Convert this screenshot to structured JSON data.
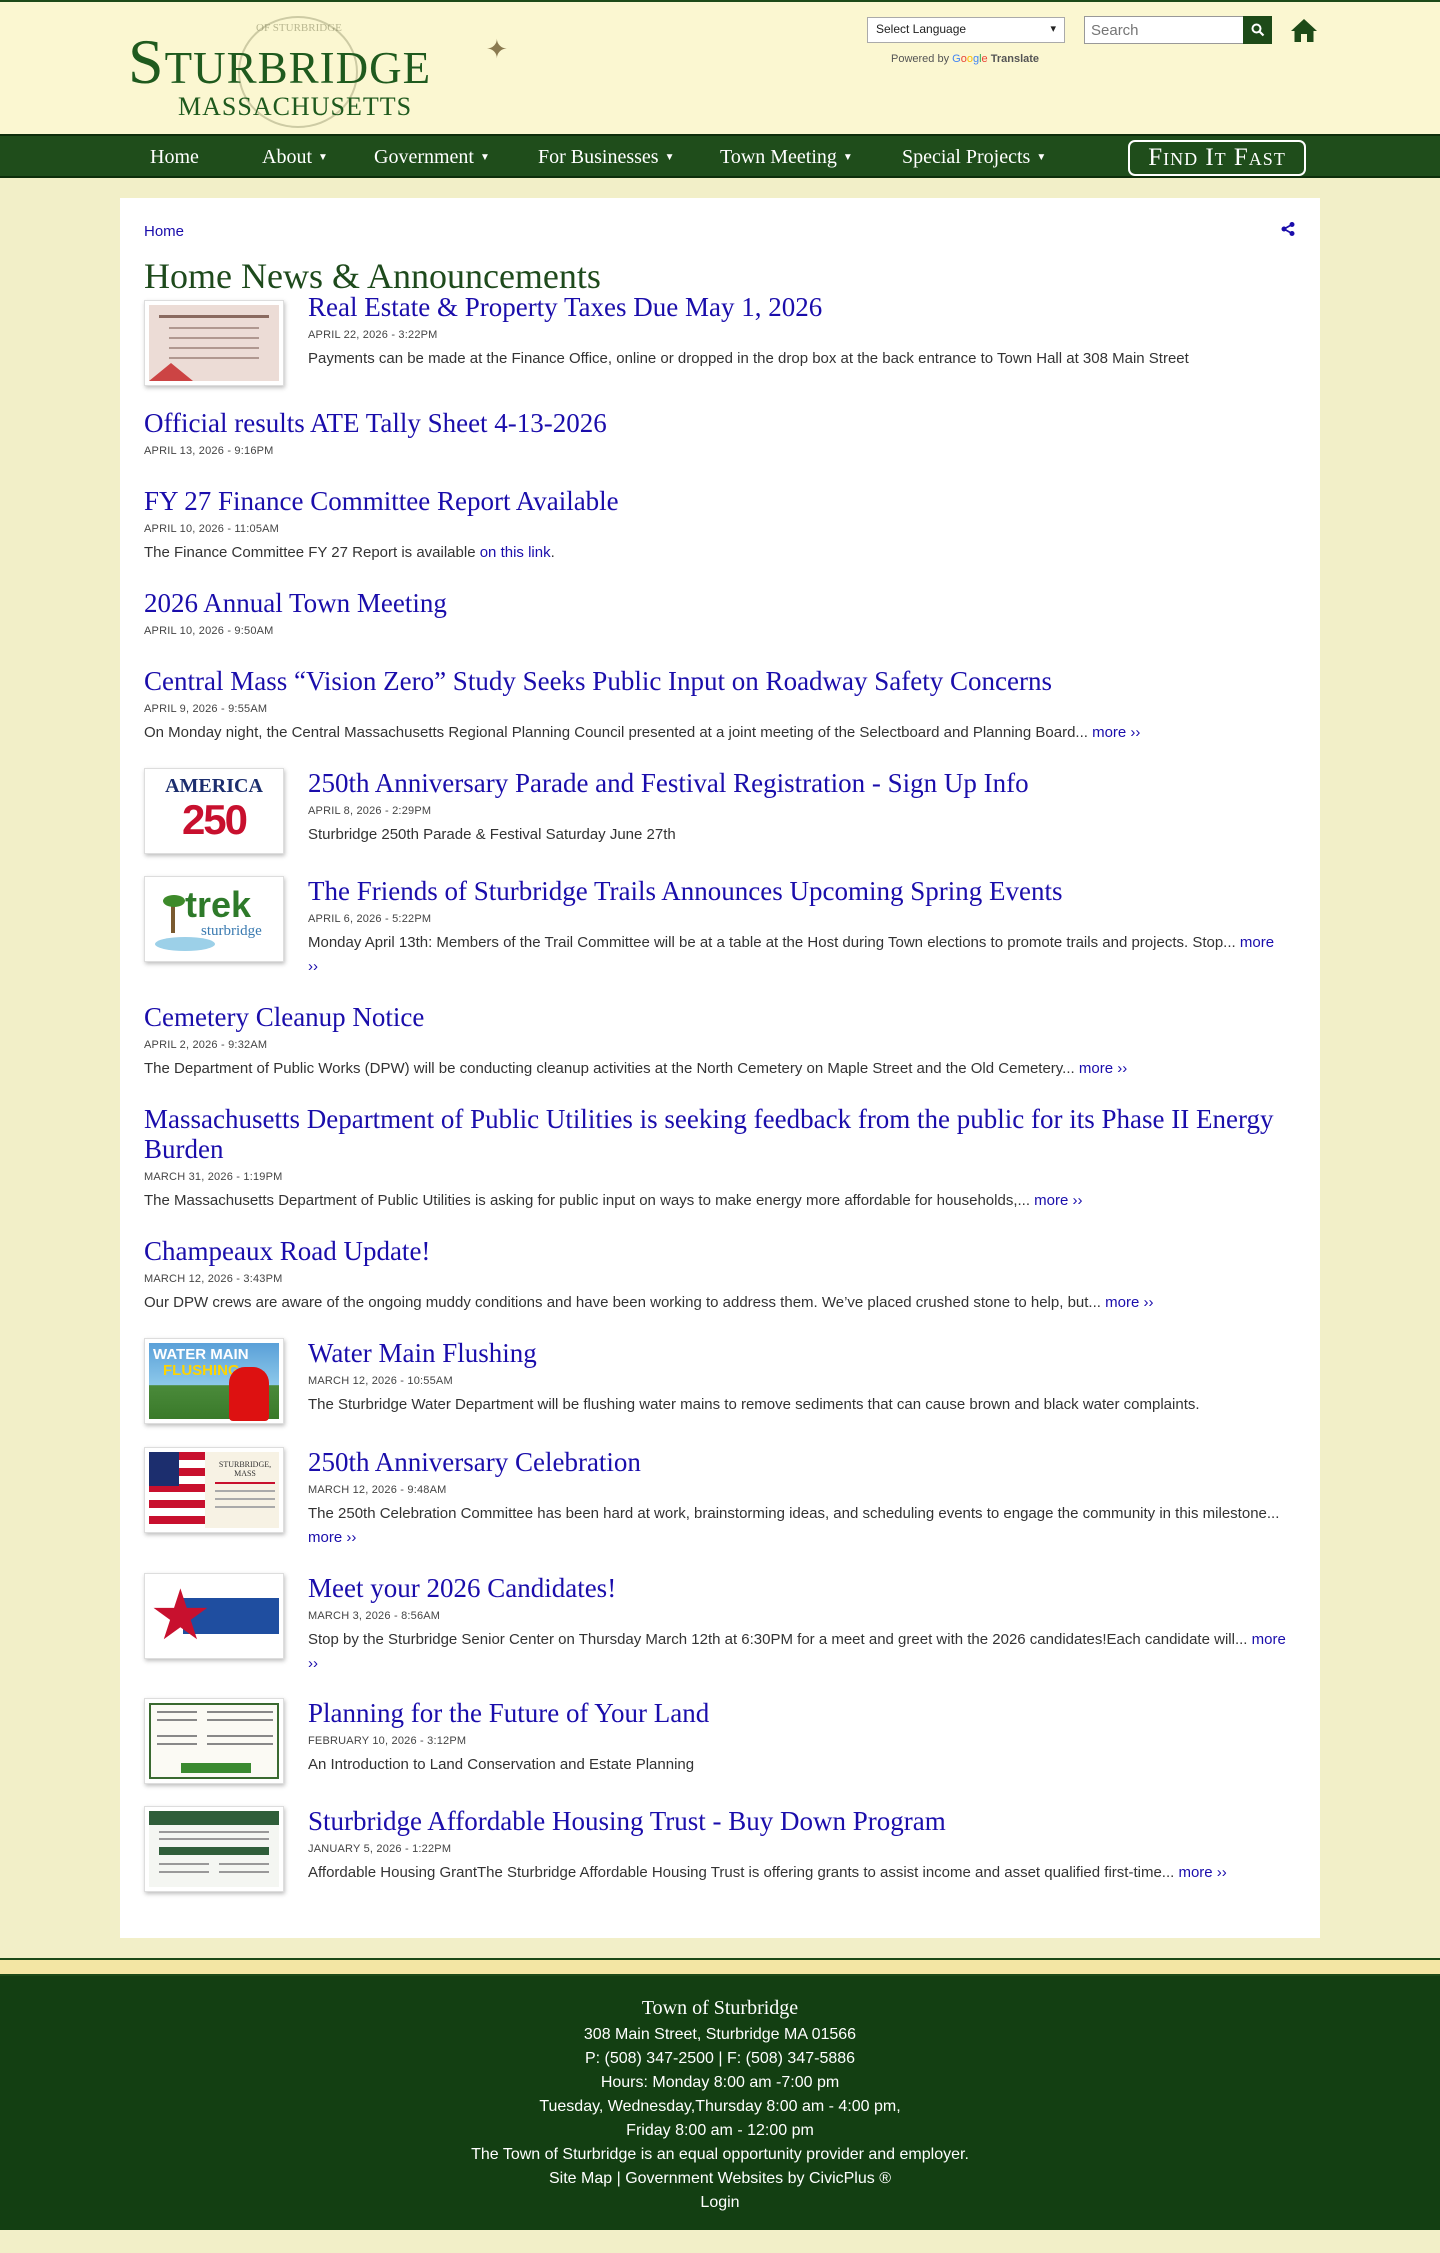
{
  "header": {
    "logo_name": "Sturbridge",
    "logo_state": "MASSACHUSETTS",
    "logo_seal_text": "OF STURBRIDGE",
    "language_select": "Select Language",
    "powered_by": "Powered by",
    "google": [
      "G",
      "o",
      "o",
      "g",
      "l",
      "e"
    ],
    "translate": "Translate",
    "search_placeholder": "Search"
  },
  "nav": {
    "items": [
      {
        "label": "Home",
        "dropdown": false
      },
      {
        "label": "About",
        "dropdown": true
      },
      {
        "label": "Government",
        "dropdown": true
      },
      {
        "label": "For Businesses",
        "dropdown": true
      },
      {
        "label": "Town Meeting",
        "dropdown": true
      },
      {
        "label": "Special Projects",
        "dropdown": true
      }
    ],
    "find_it_fast": "Find It Fast"
  },
  "breadcrumb": "Home",
  "page_title": "Home News & Announcements",
  "news": [
    {
      "title": "Real Estate & Property Taxes Due May 1, 2026",
      "date": "APRIL 22, 2026 - 3:22PM",
      "desc": "Payments can be made at the Finance Office, online or dropped in the drop box at the back entrance to Town Hall at 308 Main Street",
      "more": "",
      "link": "",
      "link_prefix": "",
      "link_suffix": ""
    },
    {
      "title": "Official results ATE Tally Sheet 4-13-2026",
      "date": "APRIL 13, 2026 - 9:16PM",
      "desc": "",
      "more": ""
    },
    {
      "title": "FY 27 Finance Committee Report Available",
      "date": "APRIL 10, 2026 - 11:05AM",
      "desc": "",
      "more": "",
      "link_prefix": "The Finance Committee FY 27 Report is available ",
      "link": "on this link",
      "link_suffix": "."
    },
    {
      "title": "2026 Annual Town Meeting",
      "date": "APRIL 10, 2026 - 9:50AM",
      "desc": "",
      "more": ""
    },
    {
      "title": "Central Mass “Vision Zero” Study Seeks Public Input on Roadway Safety Concerns",
      "date": "APRIL 9, 2026 - 9:55AM",
      "desc": "On Monday night, the Central Massachusetts Regional Planning Council presented at a joint meeting of the Selectboard and Planning Board...",
      "more": "more ››"
    },
    {
      "title": "250th Anniversary Parade and Festival Registration - Sign Up Info",
      "date": "APRIL 8, 2026 - 2:29PM",
      "desc": "Sturbridge 250th Parade & Festival Saturday June 27th",
      "more": ""
    },
    {
      "title": "The Friends of Sturbridge Trails Announces Upcoming Spring Events",
      "date": "APRIL 6, 2026 - 5:22PM",
      "desc": "Monday April 13th: Members of the Trail Committee will be at a table at the Host during Town elections to promote trails and projects. Stop...",
      "more": "more ››"
    },
    {
      "title": "Cemetery Cleanup Notice",
      "date": "APRIL 2, 2026 - 9:32AM",
      "desc": "The Department of Public Works (DPW) will be conducting cleanup activities at the North Cemetery on Maple Street and the Old Cemetery...",
      "more": "more ››"
    },
    {
      "title": "Massachusetts Department of Public Utilities is seeking feedback from the public for its Phase II Energy Burden",
      "date": "MARCH 31, 2026 - 1:19PM",
      "desc": "The Massachusetts Department of Public Utilities is asking for public input on ways to make energy more affordable for households,...",
      "more": "more ››"
    },
    {
      "title": "Champeaux Road Update!",
      "date": "MARCH 12, 2026 - 3:43PM",
      "desc": "Our DPW crews are aware of the ongoing muddy conditions and have been working to address them. We’ve placed crushed stone to help, but...",
      "more": "more ››"
    },
    {
      "title": "Water Main Flushing",
      "date": "MARCH 12, 2026 - 10:55AM",
      "desc": "The Sturbridge Water Department will be flushing water mains to remove sediments that can cause brown and black water complaints.",
      "more": ""
    },
    {
      "title": "250th Anniversary Celebration",
      "date": "MARCH 12, 2026 - 9:48AM",
      "desc": "The 250th Celebration Committee has been hard at work, brainstorming ideas, and scheduling events to engage the community in this milestone...",
      "more": "more ››"
    },
    {
      "title": "Meet your 2026 Candidates!",
      "date": "MARCH 3, 2026 - 8:56AM",
      "desc": "Stop by the Sturbridge Senior Center on Thursday March 12th at 6:30PM for a meet and greet with the  2026 candidates!Each candidate will...",
      "more": "more ››"
    },
    {
      "title": "Planning for the Future of Your Land",
      "date": "FEBRUARY 10, 2026 - 3:12PM",
      "desc": "An Introduction to Land Conservation and Estate Planning",
      "more": ""
    },
    {
      "title": "Sturbridge Affordable Housing Trust - Buy Down Program",
      "date": "JANUARY 5, 2026 - 1:22PM",
      "desc": "Affordable Housing GrantThe Sturbridge Affordable Housing Trust is offering grants to assist income and asset qualified first-time...",
      "more": "more ››"
    }
  ],
  "thumbs": {
    "america_text": "AMERICA",
    "america_num": "250",
    "trek_text": "trek",
    "trek_sub": "sturbridge",
    "water_line1": "WATER MAIN",
    "water_line2": "FLUSHING",
    "celebration_text": "STURBRIDGE, MASS"
  },
  "footer": {
    "title": "Town of Sturbridge",
    "address": "308 Main Street, Sturbridge MA 01566",
    "phone": "P: (508) 347-2500 | F: (508) 347-5886",
    "hours1": "Hours: Monday 8:00 am -7:00 pm",
    "hours2": "Tuesday, Wednesday,Thursday 8:00 am - 4:00 pm,",
    "hours3": "Friday 8:00 am - 12:00 pm",
    "equal": "The Town of Sturbridge is an equal opportunity provider and employer.",
    "sitemap": "Site Map",
    "sep": "|",
    "civicplus": "Government Websites by CivicPlus ®",
    "login": "Login"
  },
  "colors": {
    "brand_green": "#1f4d1b",
    "link_blue": "#1a0dab",
    "header_bg": "#fbf7d1"
  }
}
